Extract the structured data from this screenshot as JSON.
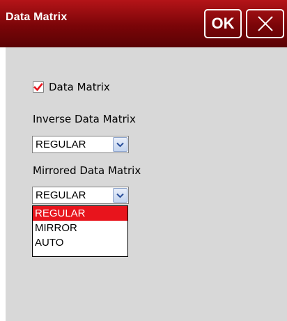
{
  "window": {
    "title": "Data Matrix",
    "ok_label": "OK",
    "close_icon": "close-icon",
    "titlebar_color": "#8a0a0c",
    "background_color": "#d8d8d8"
  },
  "form": {
    "checkbox": {
      "label": "Data Matrix",
      "checked": true,
      "check_color": "#e8141c"
    },
    "inverse": {
      "label": "Inverse Data Matrix",
      "value": "REGULAR"
    },
    "mirrored": {
      "label": "Mirrored Data Matrix",
      "value": "REGULAR"
    }
  },
  "dropdown": {
    "options": [
      "REGULAR",
      "MIRROR",
      "AUTO"
    ],
    "selected": "REGULAR",
    "highlight_color": "#e8141c"
  }
}
